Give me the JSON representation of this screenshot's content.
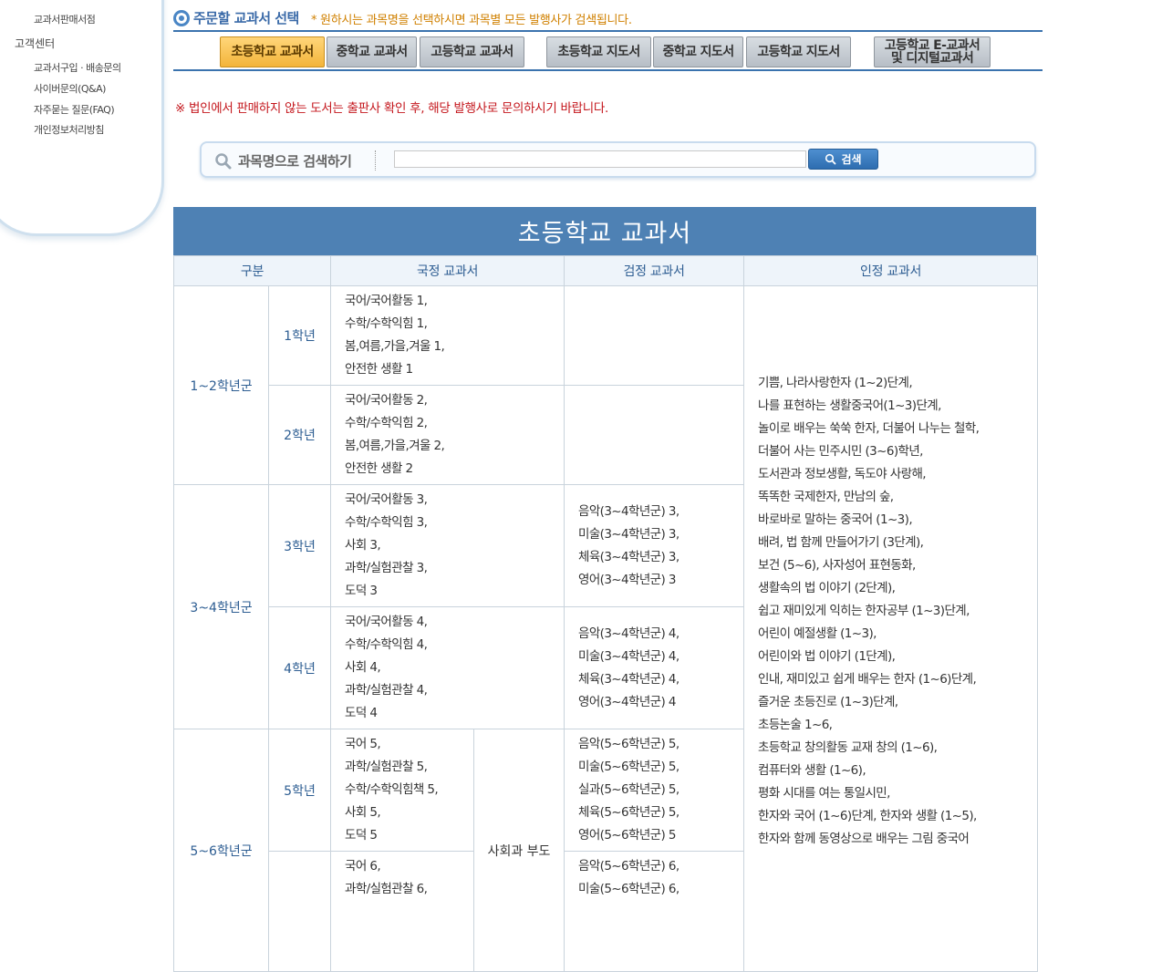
{
  "sidebar": {
    "items_top": [
      "교과서판매서점"
    ],
    "section": "고객센터",
    "items": [
      "교과서구입 · 배송문의",
      "사이버문의(Q&A)",
      "자주묻는 질문(FAQ)",
      "개인정보처리방침"
    ]
  },
  "selector": {
    "title": "주문할 교과서 선택",
    "note": "* 원하시는 과목명을 선택하시면 과목별 모든 발행사가 검색됩니다.",
    "tabs": [
      {
        "label": "초등학교 교과서",
        "active": true
      },
      {
        "label": "중학교 교과서",
        "active": false
      },
      {
        "label": "고등학교 교과서",
        "active": false
      },
      {
        "label": "초등학교 지도서",
        "active": false
      },
      {
        "label": "중학교 지도서",
        "active": false
      },
      {
        "label": "고등학교 지도서",
        "active": false
      },
      {
        "label": "고등학교 E-교과서\n및 디지털교과서",
        "active": false
      }
    ]
  },
  "warning": "※ 법인에서 판매하지 않는 도서는 출판사 확인 후, 해당 발행사로 문의하시기 바랍니다.",
  "search": {
    "label": "과목명으로 검색하기",
    "value": "",
    "button": "검색"
  },
  "table": {
    "title": "초등학교 교과서",
    "headers": [
      "구분",
      "국정 교과서",
      "검정 교과서",
      "인정 교과서"
    ],
    "groups": [
      "1~2학년군",
      "3~4학년군",
      "5~6학년군"
    ],
    "grades": [
      "1학년",
      "2학년",
      "3학년",
      "4학년",
      "5학년"
    ],
    "national": {
      "g1": [
        "국어/국어활동 1,",
        "수학/수학익힘 1,",
        "봄,여름,가을,겨울 1,",
        "안전한 생활 1"
      ],
      "g2": [
        "국어/국어활동 2,",
        "수학/수학익힘 2,",
        "봄,여름,가을,겨울 2,",
        "안전한 생활 2"
      ],
      "g3": [
        "국어/국어활동 3,",
        "수학/수학익힘 3,",
        "사회 3,",
        "과학/실험관찰 3,",
        "도덕 3"
      ],
      "g4": [
        "국어/국어활동 4,",
        "수학/수학익힘 4,",
        "사회 4,",
        "과학/실험관찰 4,",
        "도덕 4"
      ],
      "g5": [
        "국어 5,",
        "과학/실험관찰 5,",
        "수학/수학익힘책 5,",
        "사회 5,",
        "도덕 5"
      ],
      "g6": [
        "국어 6,",
        "과학/실험관찰 6,"
      ],
      "g56_extra": "사회과 부도"
    },
    "authorized": {
      "g3": [
        "음악(3~4학년군) 3,",
        "미술(3~4학년군) 3,",
        "체육(3~4학년군) 3,",
        "영어(3~4학년군) 3"
      ],
      "g4": [
        "음악(3~4학년군) 4,",
        "미술(3~4학년군) 4,",
        "체육(3~4학년군) 4,",
        "영어(3~4학년군) 4"
      ],
      "g5": [
        "음악(5~6학년군) 5,",
        "미술(5~6학년군) 5,",
        "실과(5~6학년군) 5,",
        "체육(5~6학년군) 5,",
        "영어(5~6학년군) 5"
      ],
      "g6": [
        "음악(5~6학년군) 6,",
        "미술(5~6학년군) 6,"
      ]
    },
    "approved": [
      "기쁨,   나라사랑한자 (1~2)단계,",
      "나를 표현하는 생활중국어(1~3)단계,",
      "놀이로 배우는 쑥쑥 한자,   더불어 나누는 철학,",
      "더불어 사는 민주시민 (3~6)학년,",
      "도서관과 정보생활,   독도야 사랑해,",
      "똑똑한 국제한자,   만남의 숲,",
      "바로바로 말하는 중국어 (1~3),",
      "배려,   법 함께 만들어가기 (3단계),",
      "보건 (5~6),   사자성어 표현동화,",
      "생활속의 법 이야기 (2단계),",
      "쉽고 재미있게 익히는 한자공부 (1~3)단계,",
      "어린이 예절생활 (1~3),",
      "어린이와 법 이야기 (1단계),",
      "인내,   재미있고 쉽게 배우는 한자 (1~6)단계,",
      "즐거운 초등진로 (1~3)단계,",
      "초등논술 1~6,",
      "초등학교 창의활동 교재 창의 (1~6),",
      "컴퓨터와 생활 (1~6),",
      "평화 시대를 여는 통일시민,",
      "한자와 국어 (1~6)단계,   한자와 생활 (1~5),",
      "한자와 함께 동영상으로 배우는 그림 중국어"
    ]
  },
  "colors": {
    "accent": "#4e81b4",
    "tab_active": "#f3b43a",
    "warning": "#c4161c",
    "note": "#d08000"
  }
}
